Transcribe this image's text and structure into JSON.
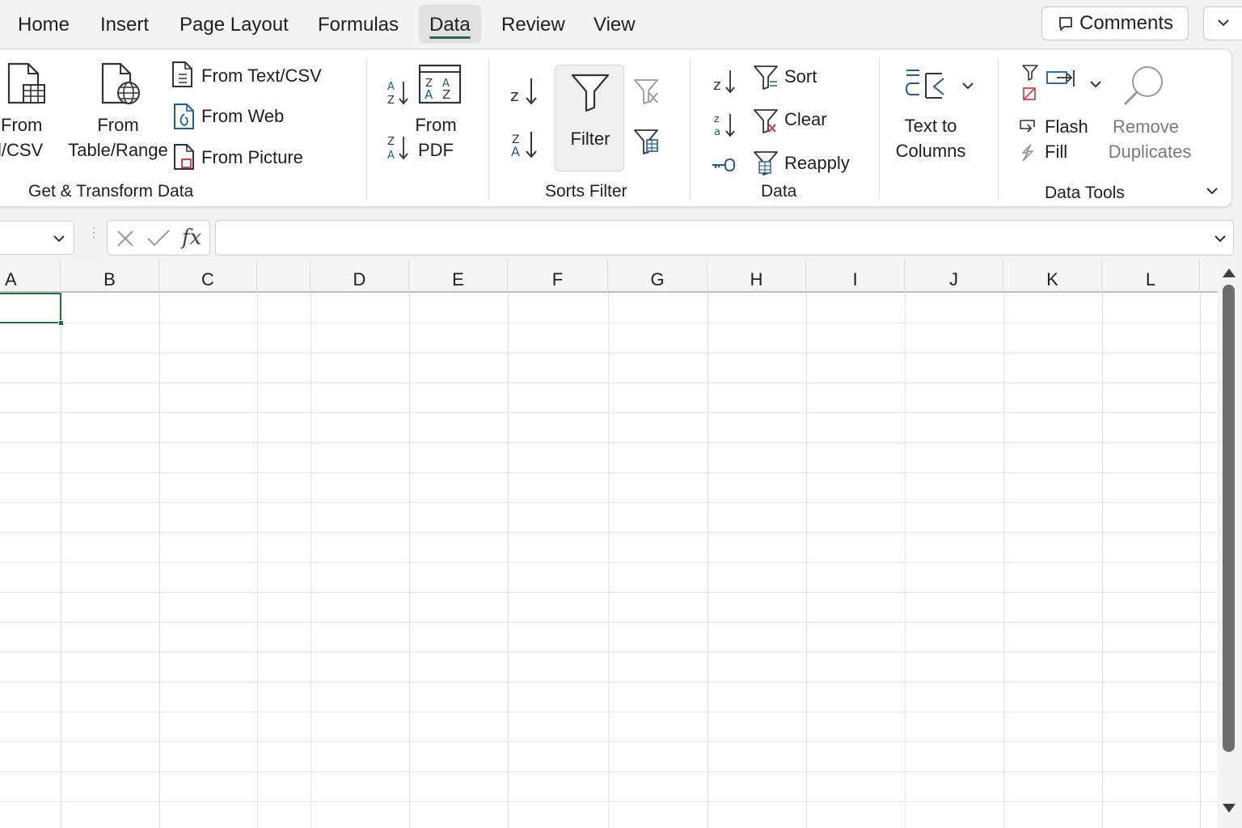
{
  "tabs": [
    {
      "label": "Home",
      "active": false
    },
    {
      "label": "Insert",
      "active": false
    },
    {
      "label": "Page Layout",
      "active": false
    },
    {
      "label": "Formulas",
      "active": false
    },
    {
      "label": "Data",
      "active": true
    },
    {
      "label": "Review",
      "active": false
    },
    {
      "label": "View",
      "active": false
    }
  ],
  "header": {
    "comments_label": "Comments"
  },
  "ribbon": {
    "get_transform": {
      "from_csv_line1": "From",
      "from_csv_line2": "l/CSV",
      "from_table_line1": "From",
      "from_table_line2": "Table/Range",
      "from_text_csv": "From Text/CSV",
      "from_web": "From Web",
      "from_picture": "From Picture",
      "title": "Get & Transform Data"
    },
    "pdf": {
      "line1": "From",
      "line2": "PDF"
    },
    "sorts_filter": {
      "filter_label": "Filter",
      "title": "Sorts Filter"
    },
    "data": {
      "sort_label": "Sort",
      "clear_label": "Clear",
      "reapply_label": "Reapply",
      "title": "Data"
    },
    "text_to_columns": {
      "line1": "Text to",
      "line2": "Columns"
    },
    "data_tools": {
      "flash_label": "Flash",
      "fill_label": "Fill",
      "remove_line1": "Remove",
      "remove_line2": "Duplicates",
      "title": "Data Tools"
    }
  },
  "formula_bar": {
    "name_box_value": "",
    "formula_value": "",
    "fx_label": "fx"
  },
  "sheet": {
    "columns": [
      "A",
      "B",
      "C",
      "",
      "D",
      "E",
      "F",
      "G",
      "H",
      "I",
      "J",
      "K",
      "L"
    ],
    "active_cell_column": "A"
  },
  "colors": {
    "accent_green": "#1e7145",
    "tab_underline": "#1f6e43",
    "icon_blue": "#1f5d99",
    "icon_red": "#d13438"
  }
}
